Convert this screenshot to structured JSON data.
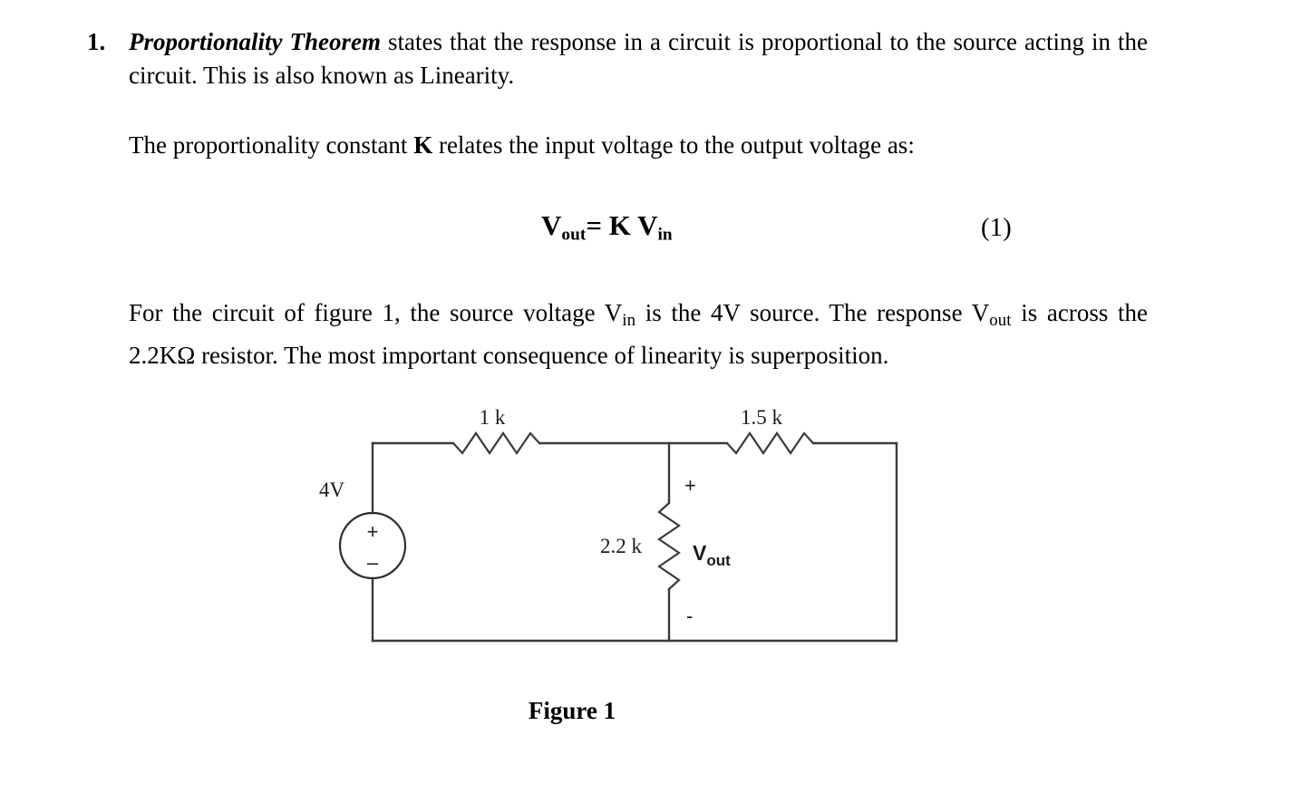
{
  "document": {
    "item_number": "1.",
    "paragraph_1": {
      "lead_bold_italic": "Proportionality Theorem",
      "rest": " states that the response in a circuit is proportional to the source acting in the circuit. This is also known as Linearity."
    },
    "paragraph_2": {
      "before_k": "The proportionality constant ",
      "k": "K",
      "after_k": " relates the input voltage to the output voltage as:"
    },
    "equation": {
      "v": "V",
      "sub_out": "out",
      "equals": "= K ",
      "v2": "V",
      "sub_in": "in",
      "number": "(1)"
    },
    "paragraph_3": {
      "seg_1": "For the circuit of figure 1, the source voltage V",
      "sub_1": "in",
      "seg_2": " is the 4V source. The response V",
      "sub_2": "out",
      "seg_3": " is across the 2.2KΩ resistor. The most important consequence of linearity is superposition."
    },
    "figure": {
      "caption": "Figure 1",
      "labels": {
        "source_value": "4V",
        "source_plus": "+",
        "source_minus": "–",
        "resistor_top_left": "1 k",
        "resistor_top_right": "1.5 k",
        "resistor_shunt": "2.2 k",
        "vout_main": "V",
        "vout_sub": "out",
        "node_plus": "+",
        "node_minus": "-"
      }
    }
  },
  "colors": {
    "page_background": "#ffffff",
    "text": "#000000",
    "circuit_stroke": "#3b3b3b",
    "circuit_label": "#1b1b1b"
  }
}
